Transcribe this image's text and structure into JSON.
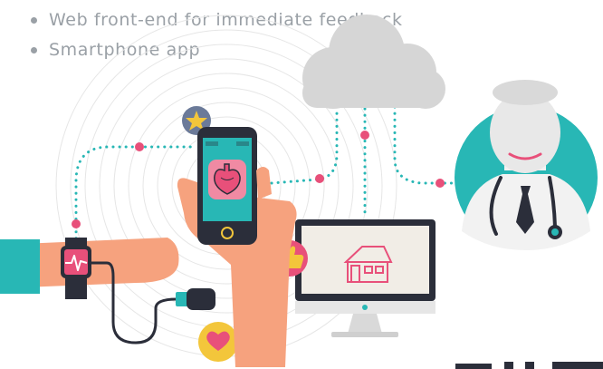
{
  "bullets": [
    {
      "label": "Web front-end for immediate feedback"
    },
    {
      "label": "Smartphone app"
    }
  ],
  "illustration": {
    "icons": [
      "star-icon",
      "cloud-icon",
      "heart-organ-icon",
      "thumbs-up-icon",
      "house-icon",
      "heart-icon",
      "doctor-avatar",
      "smartwatch",
      "sensor-device",
      "smartphone",
      "monitor"
    ],
    "colors": {
      "accent_teal": "#28b7b5",
      "accent_pink": "#e8507a",
      "skin": "#f6a27e",
      "cloud_gray": "#d6d6d6",
      "device_dark": "#2b2e3a",
      "star_badge": "#6b7a99",
      "heart_badge": "#f3c63b"
    }
  }
}
